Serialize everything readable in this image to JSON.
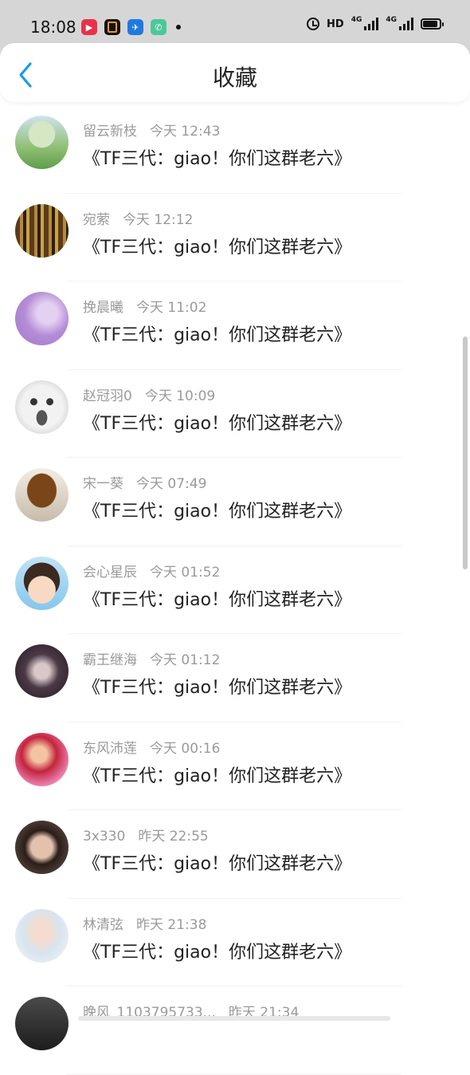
{
  "status_bar": {
    "time": "18:08",
    "hd_label": "HD",
    "network1": "4G",
    "network2": "4G",
    "app_icons": [
      {
        "name": "video-app-icon",
        "color": "#e6334a"
      },
      {
        "name": "orange-app-icon",
        "color": "#111111"
      },
      {
        "name": "blue-app-icon",
        "color": "#1f7ae0"
      },
      {
        "name": "phone-app-icon",
        "color": "#4bc89a"
      }
    ],
    "battery_level": 0.9
  },
  "header": {
    "title": "收藏",
    "back_icon": "chevron-left-icon",
    "accent": "#1a9be8"
  },
  "items": [
    {
      "name": "留云新枝",
      "time": "今天 12:43",
      "text": "《TF三代：giao！你们这群老六》",
      "avatar": "landscape-avatar"
    },
    {
      "name": "宛萦",
      "time": "今天 12:12",
      "text": "《TF三代：giao！你们这群老六》",
      "avatar": "bookshelf-avatar"
    },
    {
      "name": "挽晨曦",
      "time": "今天 11:02",
      "text": "《TF三代：giao！你们这群老六》",
      "avatar": "purple-avatar"
    },
    {
      "name": "赵冠羽0",
      "time": "今天 10:09",
      "text": "《TF三代：giao！你们这群老六》",
      "avatar": "cartoon-face-avatar"
    },
    {
      "name": "宋一葵",
      "time": "今天 07:49",
      "text": "《TF三代：giao！你们这群老六》",
      "avatar": "bread-avatar"
    },
    {
      "name": "会心星辰",
      "time": "今天 01:52",
      "text": "《TF三代：giao！你们这群老六》",
      "avatar": "child-avatar"
    },
    {
      "name": "霸王继海",
      "time": "今天 01:12",
      "text": "《TF三代：giao！你们这群老六》",
      "avatar": "anime-dark-avatar"
    },
    {
      "name": "东风沛莲",
      "time": "今天 00:16",
      "text": "《TF三代：giao！你们这群老六》",
      "avatar": "anime-pink-avatar"
    },
    {
      "name": "3x330",
      "time": "昨天 22:55",
      "text": "《TF三代：giao！你们这群老六》",
      "avatar": "portrait-avatar"
    },
    {
      "name": "林清弦",
      "time": "昨天 21:38",
      "text": "《TF三代：giao！你们这群老六》",
      "avatar": "girl-avatar"
    },
    {
      "name": "晚风_1103795733...",
      "time": "昨天 21:34",
      "text": "",
      "avatar": "dark-avatar"
    }
  ]
}
